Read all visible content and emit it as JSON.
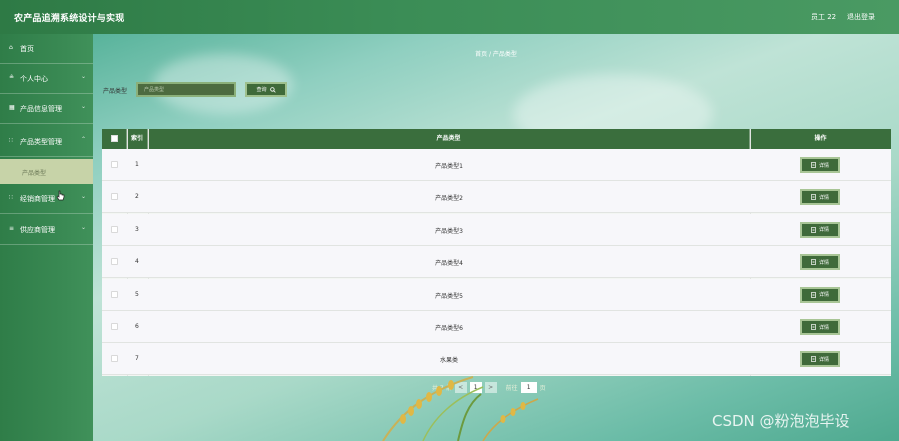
{
  "header": {
    "title": "农产品追溯系统设计与实现",
    "user": "员工 22",
    "logout": "退出登录"
  },
  "sidebar": {
    "items": [
      {
        "icon": "home-icon",
        "glyph": "⌂",
        "label": "首页",
        "chevron": false
      },
      {
        "icon": "person-icon",
        "glyph": "≗",
        "label": "个人中心",
        "chevron": true
      },
      {
        "icon": "grid-icon",
        "glyph": "▦",
        "label": "产品信息管理",
        "chevron": true
      },
      {
        "icon": "apps-icon",
        "glyph": "∷",
        "label": "产品类型管理",
        "chevron": true
      },
      {
        "icon": "apps-icon",
        "glyph": "∷",
        "label": "经销商管理",
        "chevron": true
      },
      {
        "icon": "list-icon",
        "glyph": "≡",
        "label": "供应商管理",
        "chevron": true
      }
    ],
    "submenu": {
      "label": "产品类型"
    }
  },
  "breadcrumb": "首页 / 产品类型",
  "search": {
    "label": "产品类型",
    "placeholder": "产品类型",
    "button": "查询"
  },
  "table": {
    "columns": {
      "index": "索引",
      "type": "产品类型",
      "actions": "操作"
    },
    "rows": [
      {
        "index": "1",
        "name": "产品类型1"
      },
      {
        "index": "2",
        "name": "产品类型2"
      },
      {
        "index": "3",
        "name": "产品类型3"
      },
      {
        "index": "4",
        "name": "产品类型4"
      },
      {
        "index": "5",
        "name": "产品类型5"
      },
      {
        "index": "6",
        "name": "产品类型6"
      },
      {
        "index": "7",
        "name": "水果类"
      }
    ],
    "detail_label": "详情"
  },
  "pagination": {
    "total": "共 7 条",
    "prev": "<",
    "current": "1",
    "next": ">",
    "goto_prefix": "前往",
    "goto_value": "1",
    "goto_suffix": "页"
  },
  "watermark": "CSDN @粉泡泡毕设",
  "colors": {
    "primary": "#3a6e3d",
    "header": "#2e7a45",
    "submenu": "#c7d3a8"
  }
}
